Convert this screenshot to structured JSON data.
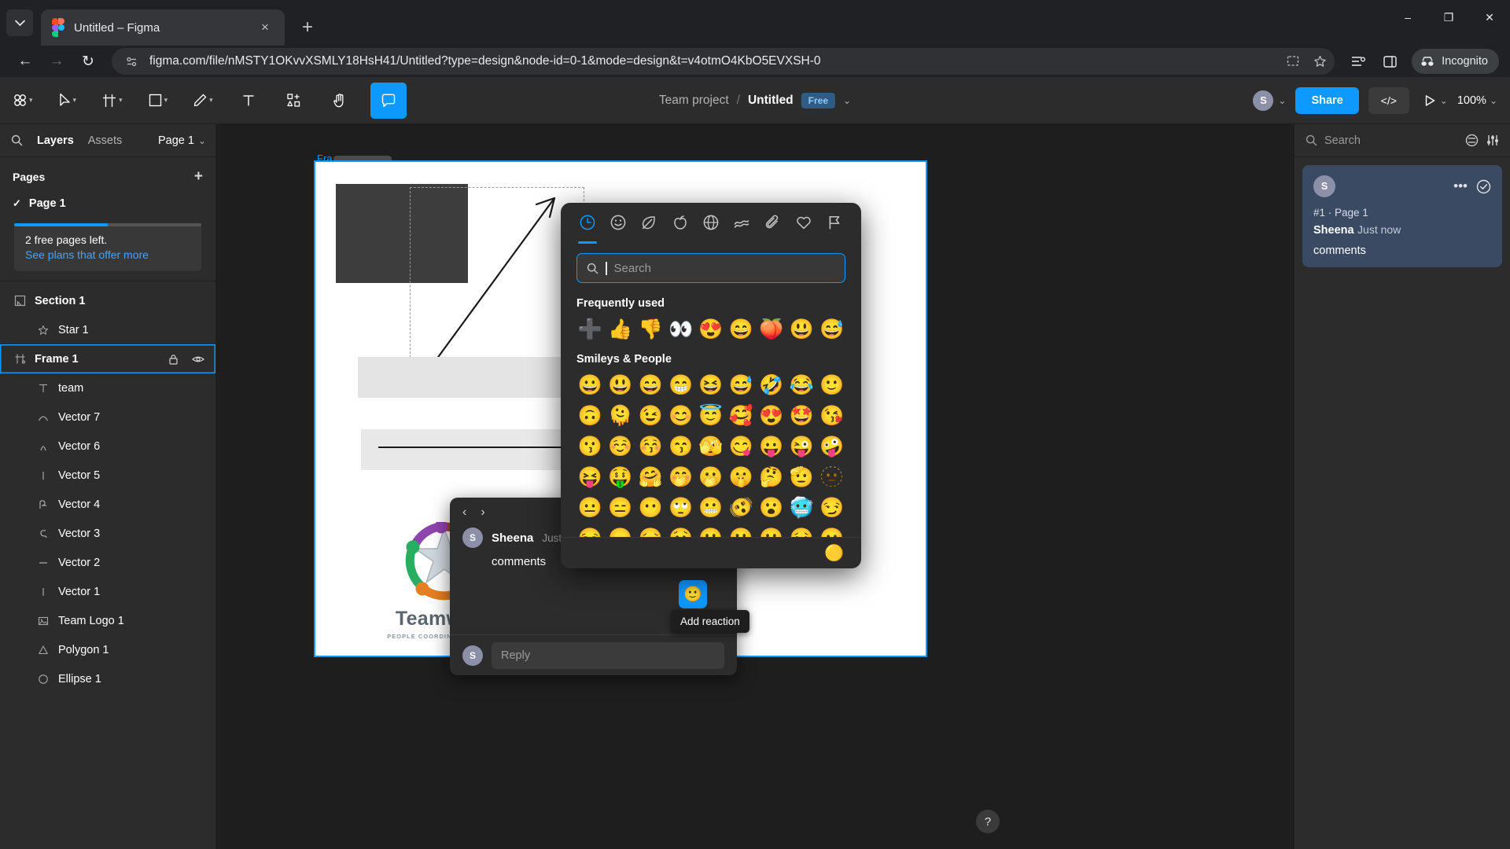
{
  "browser": {
    "tab": {
      "title": "Untitled – Figma",
      "favicon": "figma-logo-icon",
      "close_label": "×"
    },
    "tab_search_icon": "chevron-down-icon",
    "new_tab_label": "+",
    "window_controls": {
      "minimize": "–",
      "maximize": "❐",
      "close": "✕"
    },
    "nav": {
      "back": "←",
      "forward": "→",
      "reload": "↻"
    },
    "omnibox": {
      "url": "figma.com/file/nMSTY1OKvvXSMLY18HsH41/Untitled?type=design&node-id=0-1&mode=design&t=v4otmO4KbO5EVXSH-0",
      "site_info_icon": "page-settings-icon",
      "trailing_icons": [
        "install-app-icon",
        "bookmark-star-icon",
        "reading-list-icon",
        "side-panel-icon"
      ]
    },
    "incognito": {
      "label": "Incognito",
      "icon": "incognito-icon"
    }
  },
  "figma_toolbar": {
    "tools": [
      {
        "name": "main-menu",
        "icon": "figma-grid-icon",
        "caret": true,
        "active": false
      },
      {
        "name": "move",
        "icon": "cursor-icon",
        "caret": true,
        "active": false
      },
      {
        "name": "frame",
        "icon": "frame-icon",
        "caret": true,
        "active": false
      },
      {
        "name": "shape",
        "icon": "rectangle-icon",
        "caret": true,
        "active": false
      },
      {
        "name": "pen",
        "icon": "pen-icon",
        "caret": true,
        "active": false
      },
      {
        "name": "text",
        "icon": "text-icon",
        "caret": false,
        "active": false
      },
      {
        "name": "resources",
        "icon": "components-icon",
        "caret": false,
        "active": false
      },
      {
        "name": "hand",
        "icon": "hand-icon",
        "caret": false,
        "active": false
      },
      {
        "name": "comment",
        "icon": "comment-icon",
        "caret": false,
        "active": true
      }
    ],
    "breadcrumb": {
      "team": "Team project",
      "separator": "/",
      "file": "Untitled",
      "plan_badge": "Free",
      "caret": "⌄"
    },
    "avatar_initial": "S",
    "avatar_caret": "⌄",
    "share_label": "Share",
    "dev_mode_label": "</>",
    "present_icon": "play-icon",
    "present_caret": "⌄",
    "zoom_level": "100%",
    "zoom_caret": "⌄"
  },
  "left_panel": {
    "search_icon": "search-icon",
    "tabs": [
      {
        "label": "Layers",
        "active": true
      },
      {
        "label": "Assets",
        "active": false
      }
    ],
    "page_selector": {
      "label": "Page 1",
      "caret": "⌄"
    },
    "pages_header": "Pages",
    "add_page_icon": "plus-icon",
    "pages": [
      {
        "label": "Page 1",
        "checked": true
      }
    ],
    "upsell": {
      "title": "2 free pages left.",
      "link": "See plans that offer more",
      "progress_percent": 50,
      "progress_color": "#0d99ff"
    },
    "layers": [
      {
        "name": "Section 1",
        "icon": "section-icon",
        "depth": 0,
        "selected": false,
        "bold": true,
        "actions": []
      },
      {
        "name": "Star 1",
        "icon": "star-icon",
        "depth": 1,
        "selected": false,
        "bold": false,
        "actions": []
      },
      {
        "name": "Frame 1",
        "icon": "frame-icon",
        "depth": 0,
        "selected": true,
        "bold": true,
        "actions": [
          "lock-icon",
          "eye-icon"
        ]
      },
      {
        "name": "team",
        "icon": "text-icon",
        "depth": 1,
        "selected": false,
        "bold": false,
        "actions": []
      },
      {
        "name": "Vector 7",
        "icon": "vector-arc-icon",
        "depth": 1,
        "selected": false,
        "bold": false,
        "actions": []
      },
      {
        "name": "Vector 6",
        "icon": "vector-peak-icon",
        "depth": 1,
        "selected": false,
        "bold": false,
        "actions": []
      },
      {
        "name": "Vector 5",
        "icon": "vector-line-icon",
        "depth": 1,
        "selected": false,
        "bold": false,
        "actions": []
      },
      {
        "name": "Vector 4",
        "icon": "vector-shape-icon",
        "depth": 1,
        "selected": false,
        "bold": false,
        "actions": []
      },
      {
        "name": "Vector 3",
        "icon": "vector-curve-icon",
        "depth": 1,
        "selected": false,
        "bold": false,
        "actions": []
      },
      {
        "name": "Vector 2",
        "icon": "vector-dash-icon",
        "depth": 1,
        "selected": false,
        "bold": false,
        "actions": []
      },
      {
        "name": "Vector 1",
        "icon": "vector-line-icon",
        "depth": 1,
        "selected": false,
        "bold": false,
        "actions": []
      },
      {
        "name": "Team Logo 1",
        "icon": "image-icon",
        "depth": 1,
        "selected": false,
        "bold": false,
        "actions": []
      },
      {
        "name": "Polygon 1",
        "icon": "polygon-icon",
        "depth": 1,
        "selected": false,
        "bold": false,
        "actions": []
      },
      {
        "name": "Ellipse 1",
        "icon": "ellipse-icon",
        "depth": 1,
        "selected": false,
        "bold": false,
        "actions": []
      }
    ]
  },
  "canvas": {
    "frame_label": "Fra...",
    "section_chip": "Section 1",
    "logo": {
      "word": "Teamwork",
      "tagline": "PEOPLE COORDINATED EFFORT"
    },
    "thread": {
      "prev_icon": "‹",
      "next_icon": "›",
      "avatar_initial": "S",
      "author": "Sheena",
      "time": "Just now",
      "text": "comments",
      "reply_avatar_initial": "S",
      "reply_placeholder": "Reply"
    },
    "react_button": {
      "icon": "add-reaction-icon",
      "glyph": "🙂",
      "tooltip": "Add reaction"
    },
    "cursor": "hand-cursor",
    "help_label": "?"
  },
  "emoji_picker": {
    "tabs": [
      {
        "name": "recent",
        "icon": "clock-icon",
        "active": true
      },
      {
        "name": "smileys",
        "icon": "smiley-icon",
        "active": false
      },
      {
        "name": "nature",
        "icon": "leaf-icon",
        "active": false
      },
      {
        "name": "food",
        "icon": "apple-icon",
        "active": false
      },
      {
        "name": "activity",
        "icon": "ball-icon",
        "active": false
      },
      {
        "name": "travel",
        "icon": "car-icon",
        "active": false
      },
      {
        "name": "objects",
        "icon": "paperclip-icon",
        "active": false
      },
      {
        "name": "symbols",
        "icon": "heart-icon",
        "active": false
      },
      {
        "name": "flags",
        "icon": "flag-icon",
        "active": false
      }
    ],
    "search": {
      "placeholder": "Search",
      "value": "",
      "icon": "search-icon",
      "focused": true
    },
    "sections": [
      {
        "title": "Frequently used",
        "emojis": [
          "➕",
          "👍",
          "👎",
          "👀",
          "😍",
          "😄",
          "🍑",
          "😃",
          "😅"
        ]
      },
      {
        "title": "Smileys & People",
        "emojis": [
          "😀",
          "😃",
          "😄",
          "😁",
          "😆",
          "😅",
          "🤣",
          "😂",
          "🙂",
          "🙃",
          "🫠",
          "😉",
          "😊",
          "😇",
          "🥰",
          "😍",
          "🤩",
          "😘",
          "😗",
          "☺️",
          "😚",
          "😙",
          "🫣",
          "😋",
          "😛",
          "😜",
          "🤪",
          "😝",
          "🤑",
          "🤗",
          "🤭",
          "🫢",
          "🤫",
          "🤔",
          "🫡",
          "🫥",
          "😐",
          "😑",
          "😶",
          "🙄",
          "😬",
          "🫨",
          "😮",
          "🥶",
          "😏",
          "😒",
          "😞",
          "😔",
          "😟",
          "😕",
          "🙁",
          "☹️",
          "😣",
          "🫤"
        ]
      }
    ],
    "skin_tone_selector": "🟡"
  },
  "right_panel": {
    "search_placeholder": "Search",
    "search_icon": "search-icon",
    "filter_icon": "filter-icon",
    "settings_icon": "sliders-icon",
    "comment": {
      "avatar_initial": "S",
      "more_icon": "•••",
      "resolve_icon": "✓",
      "meta": "#1 · Page 1",
      "author": "Sheena",
      "when": "Just now",
      "body": "comments"
    }
  }
}
